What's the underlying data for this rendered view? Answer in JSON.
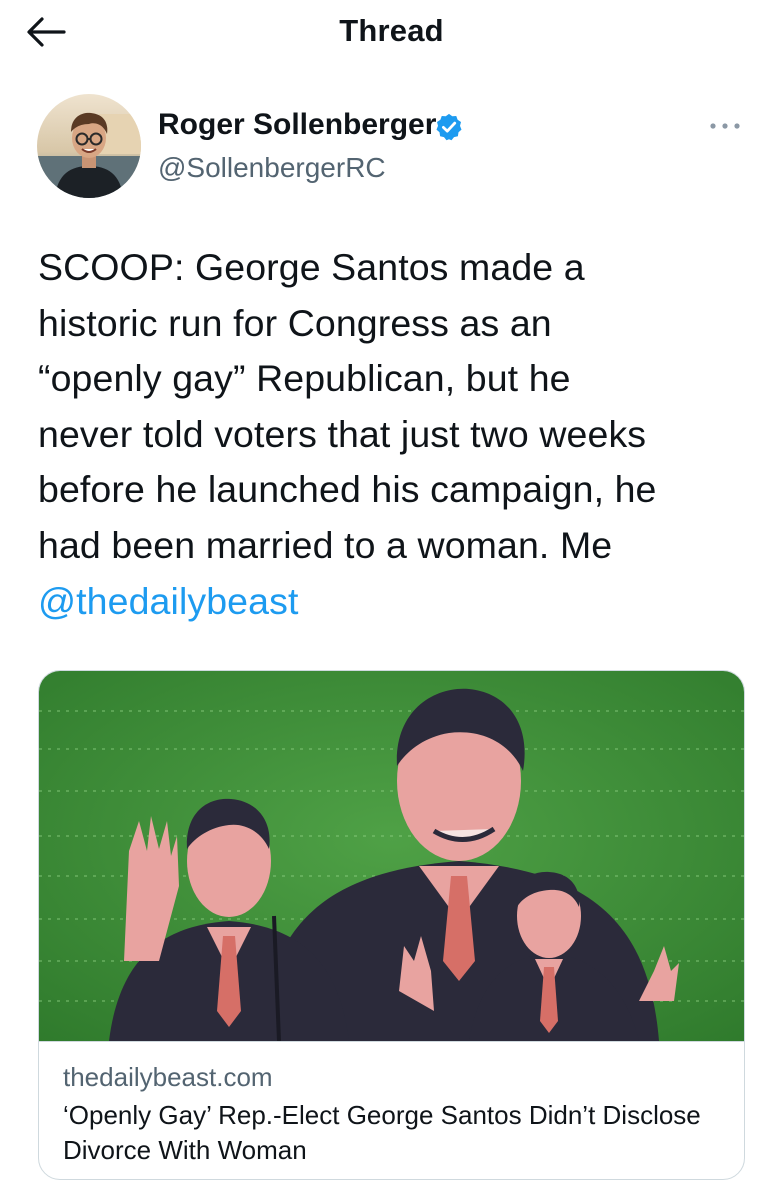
{
  "header": {
    "title": "Thread",
    "back_icon": "arrow-left-icon"
  },
  "tweet": {
    "author": {
      "name": "Roger Sollenberger",
      "handle": "@SollenbergerRC",
      "verified_icon": "verified-badge-icon",
      "avatar": "author-avatar-photo"
    },
    "more_icon": "more-horizontal-icon",
    "text_lines": [
      "SCOOP: George Santos made a",
      "historic run for Congress as an",
      "“openly gay” Republican, but he",
      "never told voters that just two weeks",
      "before he launched his campaign, he",
      "had been married to a woman. Me"
    ],
    "mention": "@thedailybeast",
    "link_card": {
      "domain": "thedailybeast.com",
      "title": "‘Openly Gay’ Rep.-Elect George Santos Didn’t Disclose Divorce With Woman",
      "image": "article-photo-collage"
    }
  },
  "colors": {
    "text": "#0f1419",
    "secondary": "#536471",
    "accent": "#1d9bf0",
    "border": "#cfd9de",
    "card_green": "#3f8f3a",
    "figure_pink": "#e8a3a0"
  }
}
